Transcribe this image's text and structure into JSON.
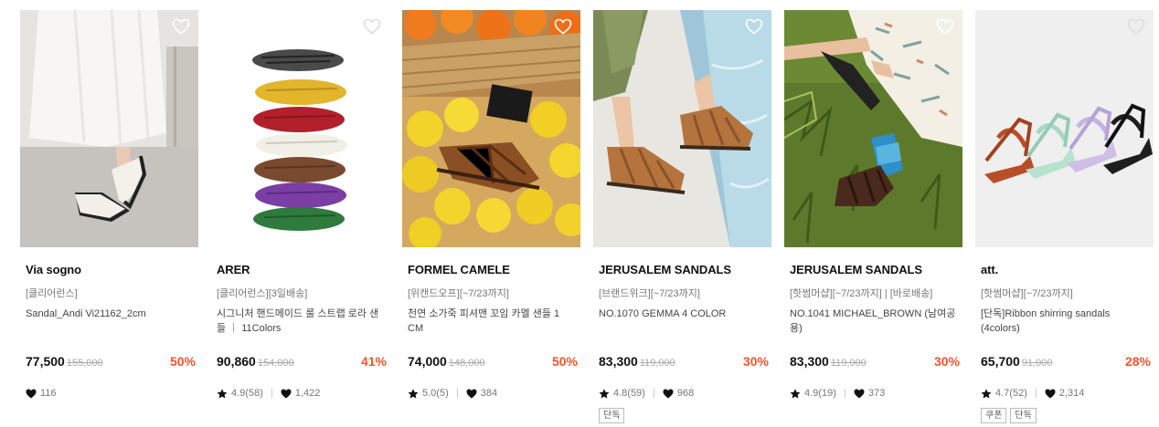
{
  "products": [
    {
      "brand": "Via sogno",
      "tag": "[클리어런스]",
      "name": "Sandal_Andi Vi21162_2cm",
      "price": "77,500",
      "original_price": "155,000",
      "discount": "50%",
      "rating": "",
      "likes": "116",
      "badges": [],
      "image_subject": "woman in white dress wearing cream thong sandals"
    },
    {
      "brand": "ARER",
      "tag": "[클리어런스][3일배송]",
      "name": "시그니처 핸드메이드 룰 스트랩 로라 샌들 ｜ 11Colors",
      "price": "90,860",
      "original_price": "154,000",
      "discount": "41%",
      "rating": "4.9(58)",
      "likes": "1,422",
      "badges": [],
      "image_subject": "stack of colored woven strap sandals"
    },
    {
      "brand": "FORMEL CAMELE",
      "tag": "[위캔드오프][~7/23까지]",
      "name": "천연 소가죽 피셔맨 꼬임 카멜 샌들 1 CM",
      "price": "74,000",
      "original_price": "148,000",
      "discount": "50%",
      "rating": "5.0(5)",
      "likes": "384",
      "badges": [],
      "image_subject": "brown fisherman sandal on lemons and oranges"
    },
    {
      "brand": "JERUSALEM SANDALS",
      "tag": "[브랜드위크][~7/23까지]",
      "name": "NO.1070 GEMMA 4 COLOR",
      "price": "83,300",
      "original_price": "119,000",
      "discount": "30%",
      "rating": "4.8(59)",
      "likes": "968",
      "badges": [
        "단독"
      ],
      "image_subject": "tan fisherman sandals by the pool"
    },
    {
      "brand": "JERUSALEM SANDALS",
      "tag": "[핫썸머샵][~7/23까지] | [바로배송]",
      "name": "NO.1041 MICHAEL_BROWN (남여공용)",
      "price": "83,300",
      "original_price": "119,000",
      "discount": "30%",
      "rating": "4.9(19)",
      "likes": "373",
      "badges": [],
      "image_subject": "person on grass wearing dark brown sandals and blue socks"
    },
    {
      "brand": "att.",
      "tag": "[핫썸머샵][~7/23까지]",
      "name": "[단독]Ribbon shirring sandals (4colors)",
      "price": "65,700",
      "original_price": "91,000",
      "discount": "28%",
      "rating": "4.7(52)",
      "likes": "2,314",
      "badges": [
        "쿠폰",
        "단독"
      ],
      "image_subject": "four ribbon sandals in rust, mint, lilac, black"
    }
  ],
  "icons": {
    "wishlist": "heart-outline-icon",
    "likes": "heart-filled-icon",
    "rating": "star-icon"
  },
  "colors": {
    "discount": "#f2542d",
    "text": "#111111",
    "muted": "#777777"
  }
}
